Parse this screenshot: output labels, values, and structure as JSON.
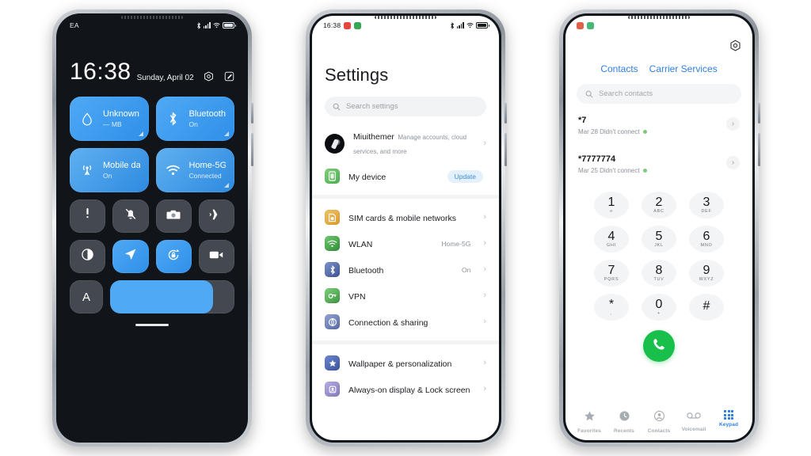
{
  "phone1": {
    "name": "control-center",
    "status": {
      "carrier": "EA",
      "icons": [
        "bluetooth-icon",
        "signal-icon",
        "wifi-icon",
        "battery-icon"
      ]
    },
    "clock": {
      "time": "16:38",
      "date": "Sunday, April 02"
    },
    "clock_actions": [
      "settings-icon",
      "edit-icon"
    ],
    "big_tiles": [
      {
        "icon": "data-drop-icon",
        "title": "Unknown data plan",
        "subtitle": "— MB",
        "state": "on"
      },
      {
        "icon": "bluetooth-icon",
        "title": "Bluetooth",
        "subtitle": "On",
        "state": "on"
      },
      {
        "icon": "mobile-data-icon",
        "title": "Mobile data",
        "subtitle": "On",
        "state": "on"
      },
      {
        "icon": "wifi-icon",
        "title": "Home-5G",
        "subtitle": "Connected",
        "state": "on"
      }
    ],
    "small_tiles": [
      {
        "icon": "flashlight-icon",
        "on": false
      },
      {
        "icon": "mute-bell-icon",
        "on": false
      },
      {
        "icon": "camera-icon",
        "on": false
      },
      {
        "icon": "airplane-icon",
        "on": false
      },
      {
        "icon": "dark-mode-icon",
        "on": false
      },
      {
        "icon": "location-icon",
        "on": true
      },
      {
        "icon": "rotation-lock-icon",
        "on": true
      },
      {
        "icon": "screen-record-icon",
        "on": false
      }
    ],
    "brightness": {
      "auto_label": "A",
      "percent": 83
    }
  },
  "phone2": {
    "name": "settings",
    "status": {
      "time": "16:38",
      "notif_colors": [
        "#e8453c",
        "#34a853"
      ]
    },
    "title": "Settings",
    "search": {
      "placeholder": "Search settings",
      "icon": "search-icon"
    },
    "account": {
      "name": "Miuithemer",
      "description": "Manage accounts, cloud services, and more",
      "avatar": "account-avatar"
    },
    "device": {
      "label": "My device",
      "badge": "Update",
      "icon": "device-icon",
      "color": "#4caf50"
    },
    "group1": [
      {
        "label": "SIM cards & mobile networks",
        "value": "",
        "icon": "sim-icon",
        "color": "#e0a33a"
      },
      {
        "label": "WLAN",
        "value": "Home-5G",
        "icon": "wlan-icon",
        "color": "#49a84c"
      },
      {
        "label": "Bluetooth",
        "value": "On",
        "icon": "bluetooth-icon",
        "color": "#5068a8"
      },
      {
        "label": "VPN",
        "value": "",
        "icon": "vpn-icon",
        "color": "#4fa34f"
      },
      {
        "label": "Connection & sharing",
        "value": "",
        "icon": "connection-icon",
        "color": "#6b7fb5"
      }
    ],
    "group2": [
      {
        "label": "Wallpaper & personalization",
        "value": "",
        "icon": "wallpaper-icon",
        "color": "#4a69b5"
      },
      {
        "label": "Always-on display & Lock screen",
        "value": "",
        "icon": "aod-icon",
        "color": "#9a8fc4"
      }
    ]
  },
  "phone3": {
    "name": "dialer",
    "status": {
      "notif_colors": [
        "#e06049",
        "#45b877"
      ]
    },
    "gear": "settings-gear-icon",
    "tabs": [
      {
        "label": "Contacts"
      },
      {
        "label": "Carrier Services"
      }
    ],
    "search": {
      "placeholder": "Search contacts",
      "icon": "search-icon"
    },
    "calls": [
      {
        "number": "*7",
        "detail": "Mar 28 Didn't connect"
      },
      {
        "number": "*7777774",
        "detail": "Mar 25 Didn't connect"
      }
    ],
    "keys": [
      {
        "digit": "1",
        "letters": "∞"
      },
      {
        "digit": "2",
        "letters": "ABC"
      },
      {
        "digit": "3",
        "letters": "DEF"
      },
      {
        "digit": "4",
        "letters": "GHI"
      },
      {
        "digit": "5",
        "letters": "JKL"
      },
      {
        "digit": "6",
        "letters": "MNO"
      },
      {
        "digit": "7",
        "letters": "PQRS"
      },
      {
        "digit": "8",
        "letters": "TUV"
      },
      {
        "digit": "9",
        "letters": "WXYZ"
      },
      {
        "digit": "*",
        "letters": ","
      },
      {
        "digit": "0",
        "letters": "+"
      },
      {
        "digit": "#",
        "letters": ""
      }
    ],
    "call_button": {
      "icon": "phone-call-icon",
      "color": "#18bf4a"
    },
    "tabbar": [
      {
        "label": "Favorites",
        "icon": "star-icon",
        "active": false
      },
      {
        "label": "Recents",
        "icon": "clock-icon",
        "active": false
      },
      {
        "label": "Contacts",
        "icon": "person-icon",
        "active": false
      },
      {
        "label": "Voicemail",
        "icon": "voicemail-icon",
        "active": false
      },
      {
        "label": "Keypad",
        "icon": "keypad-icon",
        "active": true
      }
    ],
    "accent": "#2f7fe0"
  }
}
